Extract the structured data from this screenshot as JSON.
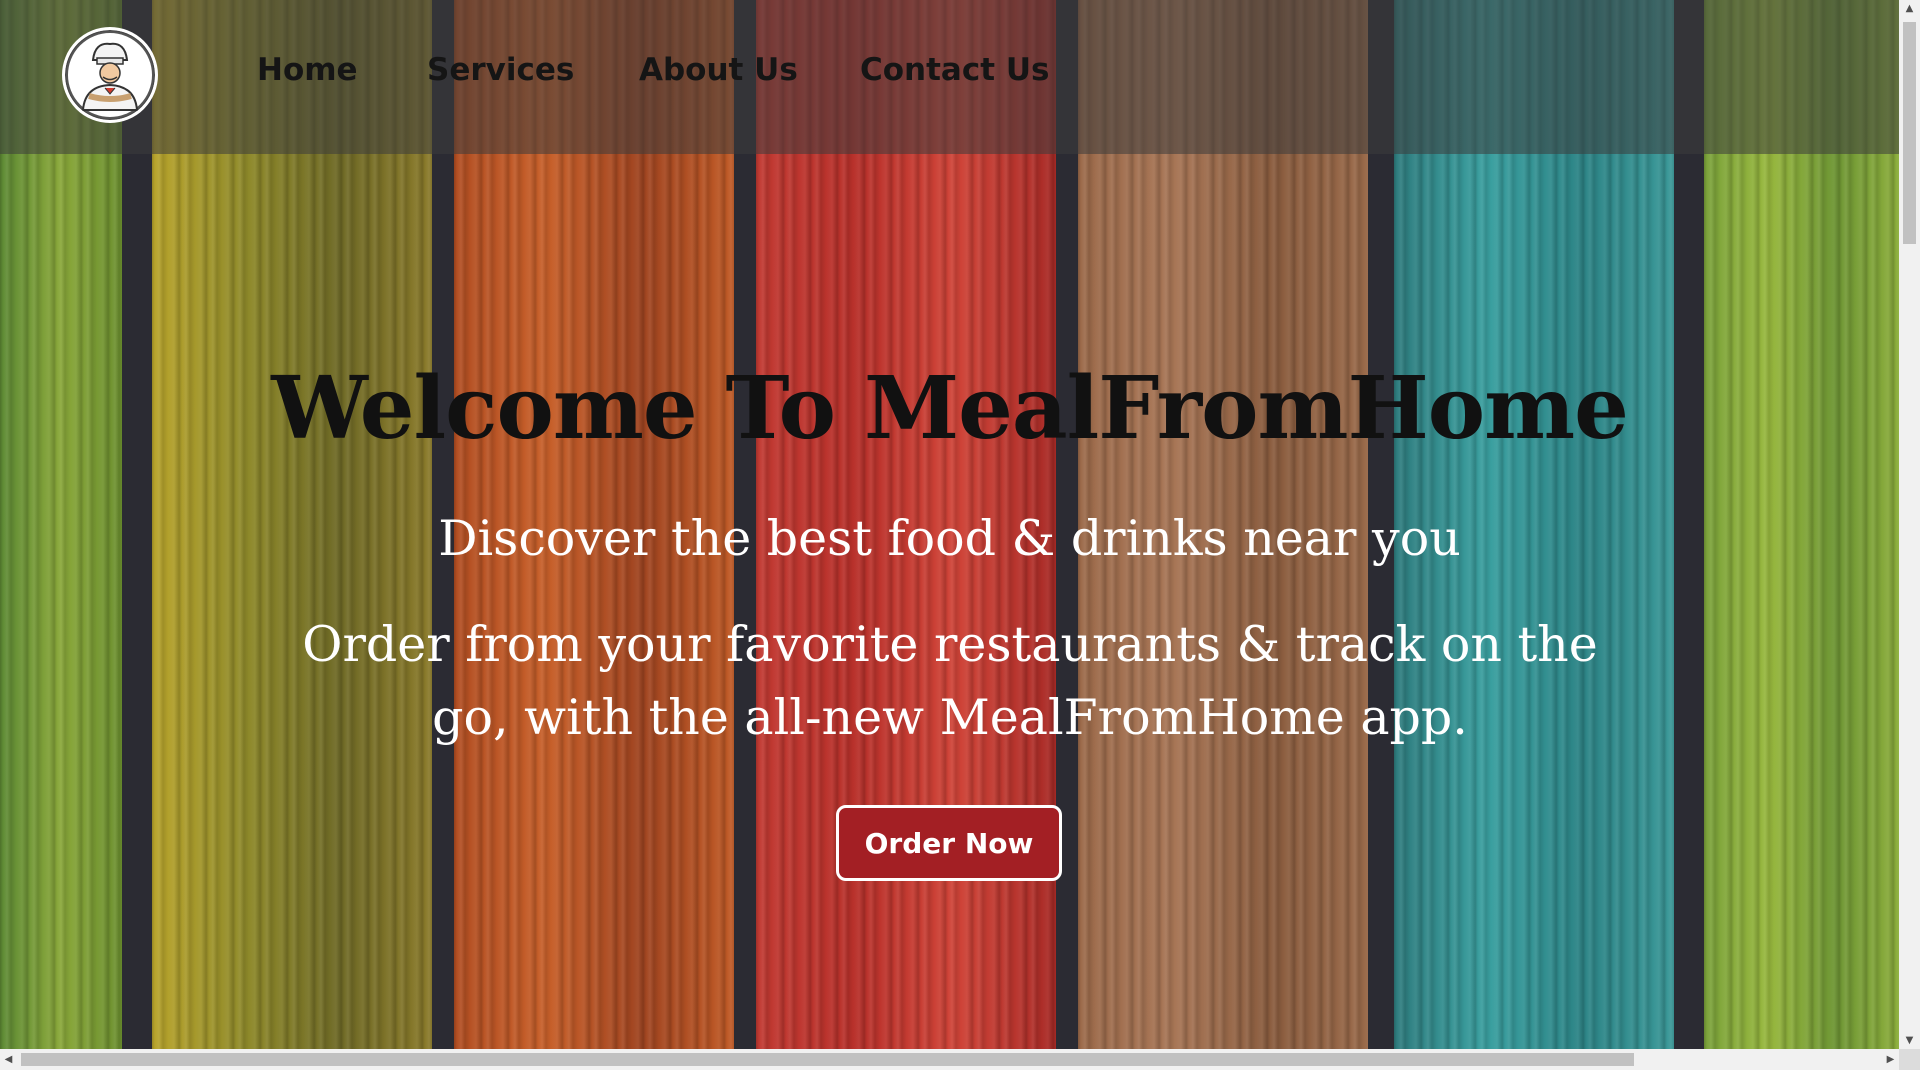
{
  "nav": {
    "logo_icon": "chef-logo-icon",
    "links": [
      "Home",
      "Services",
      "About Us",
      "Contact Us"
    ]
  },
  "hero": {
    "title": "Welcome To MealFromHome",
    "subtitle": "Discover the best food & drinks near you",
    "description": "Order from your favorite restaurants & track on the go, with the all-new MealFromHome app.",
    "cta_label": "Order Now"
  },
  "colors": {
    "nav_background": "#3c3c3c",
    "cta_background": "#a31f24",
    "title_text": "#111111",
    "body_text": "#ffffff"
  },
  "icons": {
    "scroll_up": "caret-up-icon",
    "scroll_down": "caret-down-icon",
    "scroll_left": "caret-left-icon",
    "scroll_right": "caret-right-icon"
  }
}
